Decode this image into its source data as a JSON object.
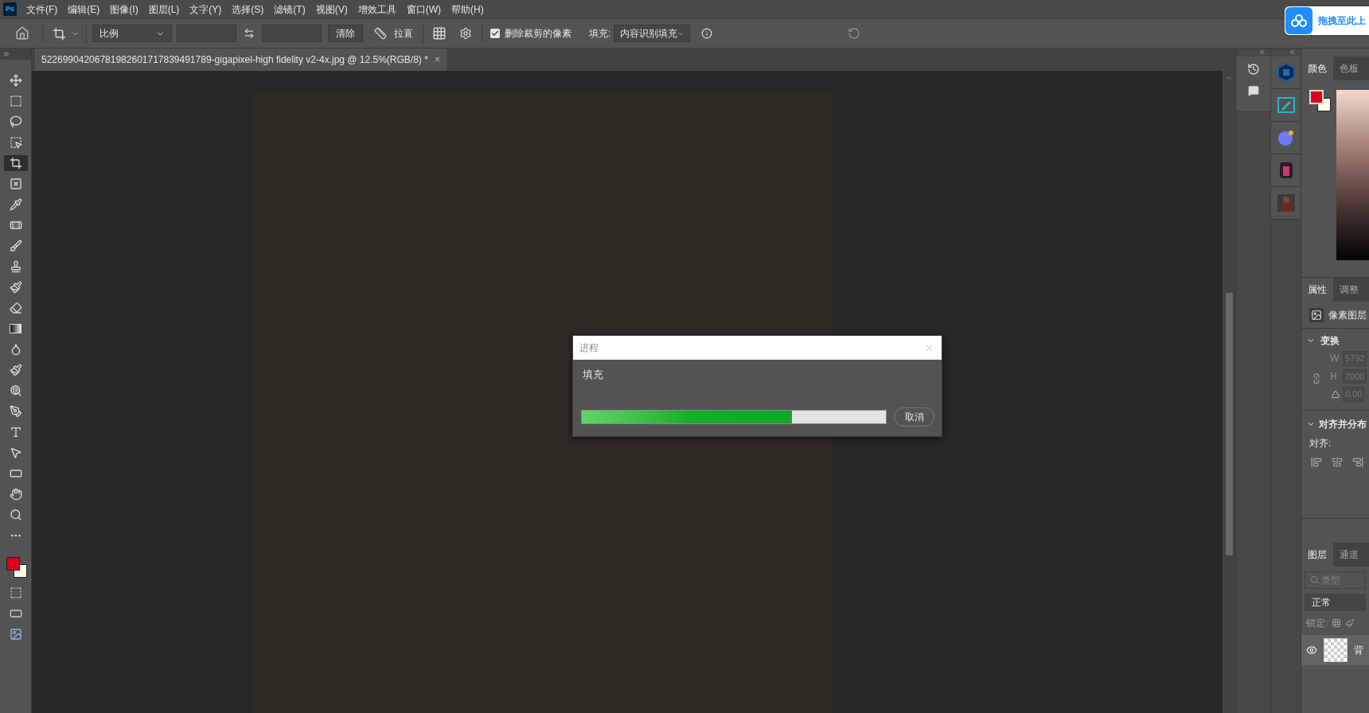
{
  "app_logo": "Ps",
  "menu": [
    "文件(F)",
    "编辑(E)",
    "图像(I)",
    "图层(L)",
    "文字(Y)",
    "选择(S)",
    "滤镜(T)",
    "视图(V)",
    "增效工具",
    "窗口(W)",
    "帮助(H)"
  ],
  "upload_button": {
    "label": "拖拽至此上"
  },
  "options_bar": {
    "ratio_dropdown": "比例",
    "clear_button": "清除",
    "straighten_button": "拉直",
    "delete_cropped": {
      "label": "删除裁剪的像素",
      "checked": true
    },
    "fill_label": "填充:",
    "fill_dropdown": "内容识别填充"
  },
  "document_tab": {
    "title": "52269904206781982601717839491789-gigapixel-high fidelity v2-4x.jpg @ 12.5%(RGB/8) *",
    "close": "×"
  },
  "tools": [
    {
      "kind": "move",
      "selected": false
    },
    {
      "kind": "marquee",
      "selected": false
    },
    {
      "kind": "lasso",
      "selected": false
    },
    {
      "kind": "object-select",
      "selected": false
    },
    {
      "kind": "crop",
      "selected": true
    },
    {
      "kind": "frame",
      "selected": false
    },
    {
      "kind": "eyedropper",
      "selected": false
    },
    {
      "kind": "healing",
      "selected": false
    },
    {
      "kind": "brush",
      "selected": false
    },
    {
      "kind": "stamp",
      "selected": false
    },
    {
      "kind": "history-brush",
      "selected": false
    },
    {
      "kind": "eraser",
      "selected": false
    },
    {
      "kind": "gradient",
      "selected": false
    },
    {
      "kind": "blur",
      "selected": false
    },
    {
      "kind": "mixer",
      "selected": false
    },
    {
      "kind": "dodge",
      "selected": false
    },
    {
      "kind": "pen",
      "selected": false
    },
    {
      "kind": "type",
      "selected": false
    },
    {
      "kind": "path-select",
      "selected": false
    },
    {
      "kind": "rectangle",
      "selected": false
    },
    {
      "kind": "hand",
      "selected": false
    },
    {
      "kind": "zoom",
      "selected": false
    },
    {
      "kind": "more",
      "selected": false
    }
  ],
  "dialog": {
    "title": "进程",
    "message": "填充",
    "progress": {
      "level": 0.69
    },
    "cancel_button": "取消"
  },
  "color_panel": {
    "tabs": [
      {
        "label": "颜色",
        "selected": true
      },
      {
        "label": "色板",
        "selected": false
      }
    ]
  },
  "properties_panel": {
    "tabs": [
      {
        "label": "属性",
        "selected": true
      },
      {
        "label": "调整",
        "selected": false
      }
    ],
    "layer_type": "像素图层",
    "transform": {
      "title": "变换",
      "expanded": true,
      "w_label": "W",
      "w_value": "5792",
      "h_label": "H",
      "h_value": "7000",
      "angle_value": "0.00"
    },
    "align": {
      "title": "对齐并分布",
      "expanded": true,
      "label": "对齐:"
    }
  },
  "layers_panel": {
    "tabs": [
      {
        "label": "图层",
        "selected": true
      },
      {
        "label": "通道",
        "selected": false
      }
    ],
    "search_placeholder": "类型",
    "blend_mode": "正常",
    "lock_label": "锁定:",
    "layers": [
      {
        "name": "背",
        "visible": true
      }
    ]
  }
}
